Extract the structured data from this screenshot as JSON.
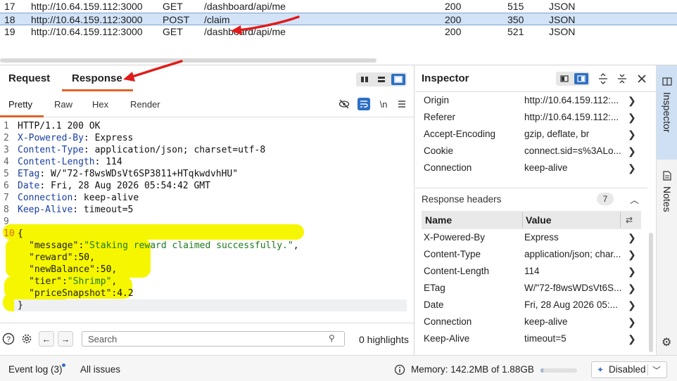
{
  "history": {
    "rows": [
      {
        "id": "17",
        "host": "http://10.64.159.112:3000",
        "method": "GET",
        "path": "/dashboard/api/me",
        "status": "200",
        "length": "515",
        "mime": "JSON"
      },
      {
        "id": "18",
        "host": "http://10.64.159.112:3000",
        "method": "POST",
        "path": "/claim",
        "status": "200",
        "length": "350",
        "mime": "JSON"
      },
      {
        "id": "19",
        "host": "http://10.64.159.112:3000",
        "method": "GET",
        "path": "/dashboard/api/me",
        "status": "200",
        "length": "521",
        "mime": "JSON"
      }
    ]
  },
  "message_editor": {
    "tabs": [
      "Request",
      "Response"
    ],
    "active_tab": "Response",
    "view_tabs": [
      "Pretty",
      "Raw",
      "Hex",
      "Render"
    ],
    "active_view": "Pretty",
    "newline_toggle": "\\n",
    "lines": [
      {
        "num": "1",
        "text": "HTTP/1.1 200 OK"
      },
      {
        "num": "2",
        "key": "X-Powered-By",
        "value": " Express"
      },
      {
        "num": "3",
        "key": "Content-Type",
        "value": " application/json; charset=utf-8"
      },
      {
        "num": "4",
        "key": "Content-Length",
        "value": " 114"
      },
      {
        "num": "5",
        "key": "ETag",
        "value": " W/\"72-f8wsWDsVt6SP3811+HTqkwdvhHU\""
      },
      {
        "num": "6",
        "key": "Date",
        "value": " Fri, 28 Aug 2026 05:54:42 GMT"
      },
      {
        "num": "7",
        "key": "Connection",
        "value": " keep-alive"
      },
      {
        "num": "8",
        "key": "Keep-Alive",
        "value": " timeout=5"
      },
      {
        "num": "9",
        "text": ""
      },
      {
        "num": "10",
        "text": "{"
      },
      {
        "num": "",
        "jkey": "\"message\"",
        "jval": "\"Staking reward claimed successfully.\"",
        "jtype": "string",
        "trail": ","
      },
      {
        "num": "",
        "jkey": "\"reward\"",
        "jval": "50",
        "jtype": "number",
        "trail": ","
      },
      {
        "num": "",
        "jkey": "\"newBalance\"",
        "jval": "50",
        "jtype": "number",
        "trail": ","
      },
      {
        "num": "",
        "jkey": "\"tier\"",
        "jval": "\"Shrimp\"",
        "jtype": "string",
        "trail": ","
      },
      {
        "num": "",
        "jkey": "\"priceSnapshot\"",
        "jval": "4.2",
        "jtype": "number",
        "trail": ""
      },
      {
        "num": "",
        "text": "}"
      }
    ],
    "search_placeholder": "Search",
    "highlights": "0 highlights"
  },
  "inspector": {
    "title": "Inspector",
    "request_headers": [
      {
        "name": "Origin",
        "value": "http://10.64.159.112:..."
      },
      {
        "name": "Referer",
        "value": "http://10.64.159.112:..."
      },
      {
        "name": "Accept-Encoding",
        "value": "gzip, deflate, br"
      },
      {
        "name": "Cookie",
        "value": "connect.sid=s%3ALo..."
      },
      {
        "name": "Connection",
        "value": "keep-alive"
      }
    ],
    "response_section": {
      "title": "Response headers",
      "count": "7"
    },
    "table_header": {
      "name": "Name",
      "value": "Value"
    },
    "response_headers": [
      {
        "name": "X-Powered-By",
        "value": "Express"
      },
      {
        "name": "Content-Type",
        "value": "application/json; char..."
      },
      {
        "name": "Content-Length",
        "value": "114"
      },
      {
        "name": "ETag",
        "value": "W/\"72-f8wsWDsVt6S..."
      },
      {
        "name": "Date",
        "value": "Fri, 28 Aug 2026 05:..."
      },
      {
        "name": "Connection",
        "value": "keep-alive"
      },
      {
        "name": "Keep-Alive",
        "value": "timeout=5"
      }
    ]
  },
  "side_tabs": [
    "Inspector",
    "Notes"
  ],
  "status_bar": {
    "event_log": "Event log (3)",
    "all_issues": "All issues",
    "memory": "Memory: 142.2MB of 1.88GB",
    "memory_fraction": 0.07,
    "ai_state": "Disabled"
  },
  "colors": {
    "accent": "#e0632a",
    "selection": "#d2e3f7",
    "highlighter": "#f6f600",
    "annotation_arrow": "#e01b1b",
    "toggle_active": "#2d6fc4"
  }
}
